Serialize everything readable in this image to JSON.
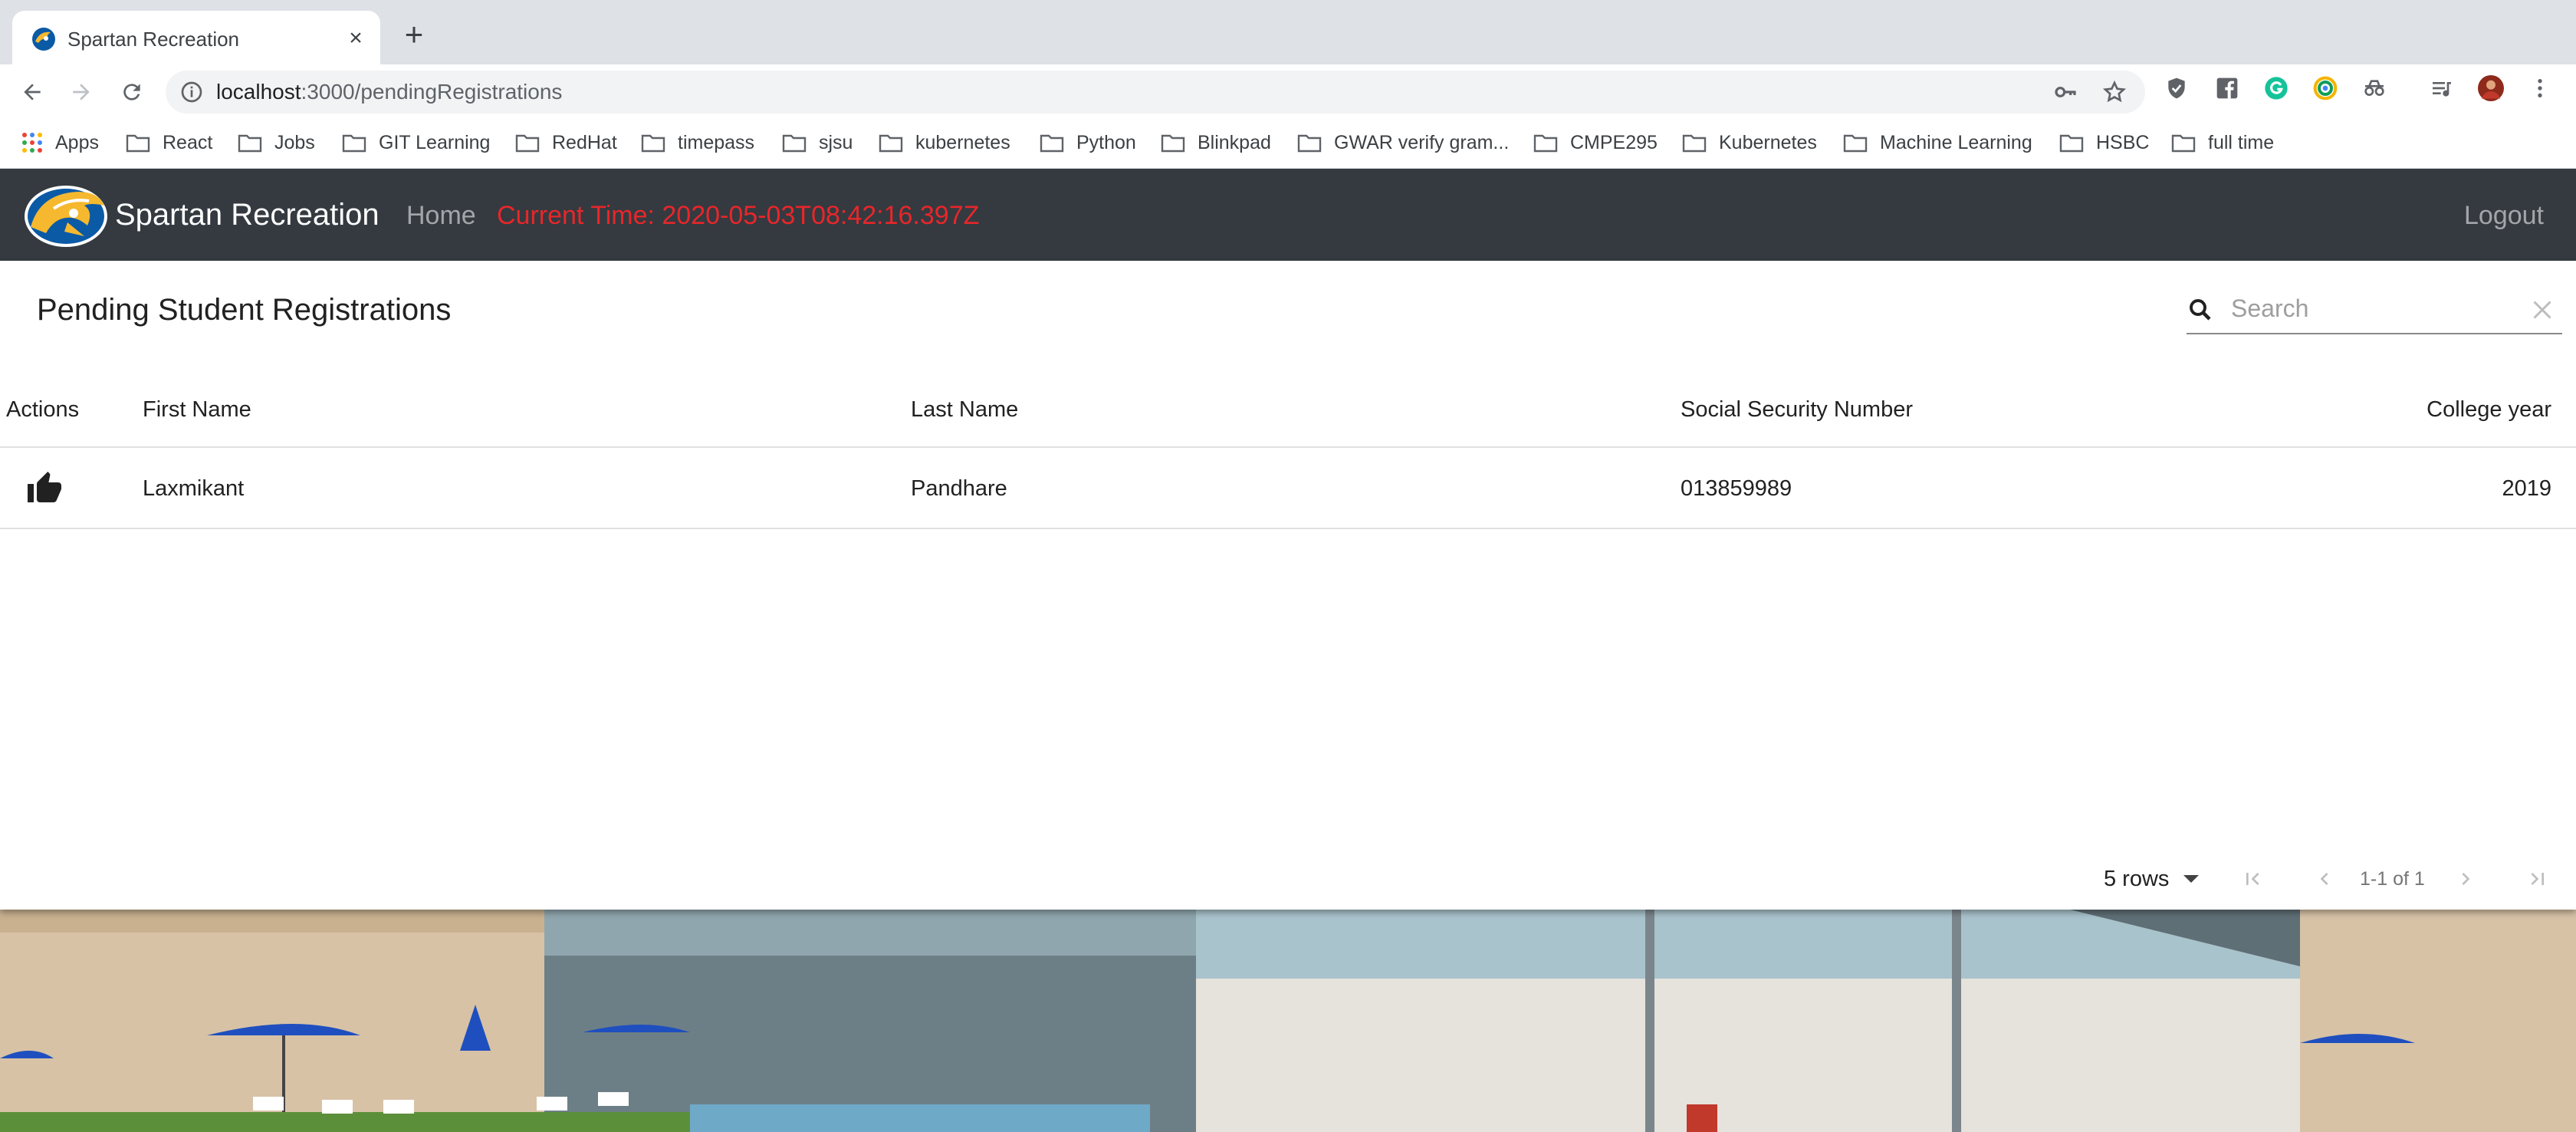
{
  "browser": {
    "tab_title": "Spartan Recreation",
    "url_host": "localhost",
    "url_path": ":3000/pendingRegistrations",
    "bookmarks": [
      "Apps",
      "React",
      "Jobs",
      "GIT Learning",
      "RedHat",
      "timepass",
      "sjsu",
      "kubernetes",
      "Python",
      "Blinkpad",
      "GWAR verify gram...",
      "CMPE295",
      "Kubernetes",
      "Machine Learning",
      "HSBC",
      "full time"
    ]
  },
  "navbar": {
    "brand": "Spartan Recreation",
    "home": "Home",
    "current_time": "Current Time: 2020-05-03T08:42:16.397Z",
    "logout": "Logout"
  },
  "table": {
    "title": "Pending Student Registrations",
    "search_placeholder": "Search",
    "columns": [
      "Actions",
      "First Name",
      "Last Name",
      "Social Security Number",
      "College year"
    ],
    "rows": [
      {
        "first_name": "Laxmikant",
        "last_name": "Pandhare",
        "ssn": "013859989",
        "college_year": "2019"
      }
    ],
    "rows_per_page": "5 rows",
    "page_info": "1-1 of 1"
  },
  "colors": {
    "navbar_bg": "#343a40",
    "time_text": "#e8262a",
    "chrome_bg": "#dee1e6"
  },
  "icons": {
    "action": "thumb-up-icon",
    "search": "search-icon",
    "clear": "close-icon"
  }
}
